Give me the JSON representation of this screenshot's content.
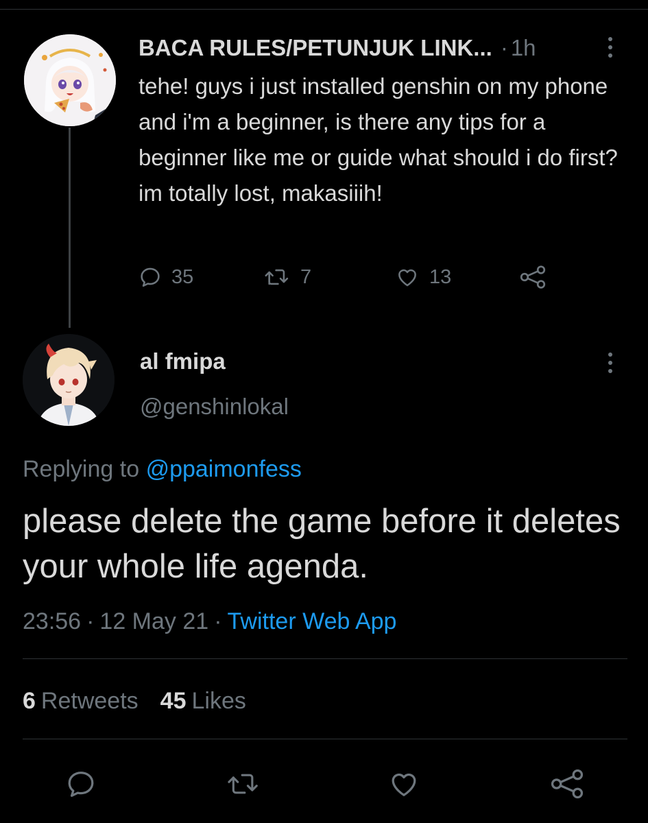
{
  "parent_tweet": {
    "display_name": "BACA RULES/PETUNJUK LINK...",
    "separator": "·",
    "time": "1h",
    "text": "tehe! guys i just installed genshin on my phone and i'm a beginner, is there any tips for a beginner like me or guide what should i do first? im totally lost, makasiiih!",
    "reply_count": "35",
    "retweet_count": "7",
    "like_count": "13"
  },
  "reply_tweet": {
    "display_name": "al fmipa",
    "handle": "@genshinlokal",
    "replying_to_label": "Replying to",
    "replying_to_handle": "@ppaimonfess",
    "text": "please delete the game before it deletes your whole life agenda.",
    "time": "23:56",
    "meta_separator": "·",
    "date": "12 May 21",
    "source": "Twitter Web App"
  },
  "stats": {
    "retweets_count": "6",
    "retweets_label": "Retweets",
    "likes_count": "45",
    "likes_label": "Likes"
  },
  "icons": {
    "reply": "reply-icon",
    "retweet": "retweet-icon",
    "like": "heart-icon",
    "share": "share-icon",
    "more": "more-vertical-icon"
  },
  "colors": {
    "background": "#000000",
    "text": "#d9d9d9",
    "muted": "#6e767d",
    "link": "#1d9bf0",
    "divider": "#2f3336"
  }
}
